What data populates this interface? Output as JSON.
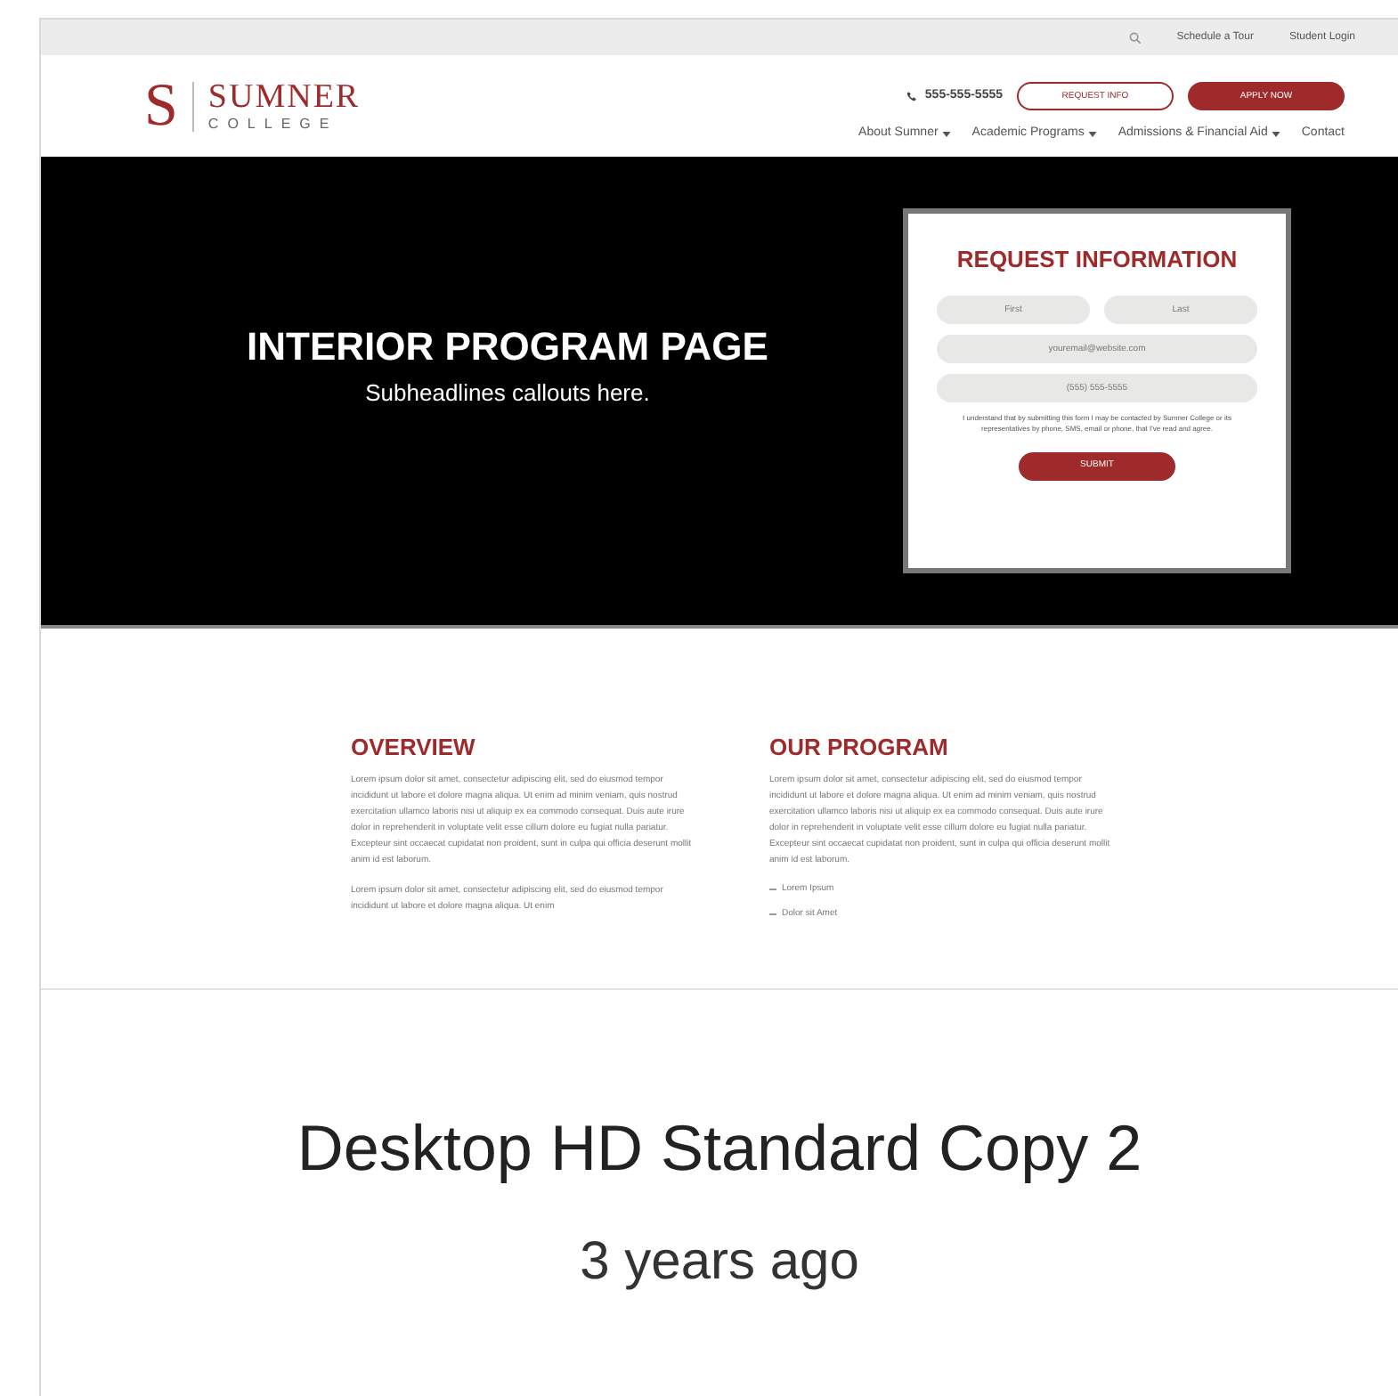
{
  "preview": {
    "utility_bar": {
      "links": [
        "Schedule a Tour",
        "Student Login"
      ]
    },
    "header": {
      "logo_mark": "S",
      "logo_name": "SUMNER",
      "logo_sub": "COLLEGE",
      "phone": "555-555-5555",
      "buttons": [
        {
          "label": "REQUEST INFO",
          "kind": "outline"
        },
        {
          "label": "APPLY NOW",
          "kind": "filled"
        }
      ],
      "nav": [
        {
          "label": "About Sumner",
          "dropdown": true
        },
        {
          "label": "Academic Programs",
          "dropdown": true
        },
        {
          "label": "Admissions & Financial Aid",
          "dropdown": true
        },
        {
          "label": "Contact",
          "dropdown": false
        }
      ]
    },
    "hero": {
      "title": "INTERIOR PROGRAM PAGE",
      "subtitle": "Subheadlines callouts here.",
      "form": {
        "title": "REQUEST INFORMATION",
        "fields": [
          [
            {
              "placeholder": "First"
            },
            {
              "placeholder": "Last"
            }
          ],
          [
            {
              "placeholder": "youremail@website.com"
            }
          ],
          [
            {
              "placeholder": "(555) 555-5555"
            }
          ]
        ],
        "disclaimer": "I understand that by submitting this form I may be contacted by Sumner College or its representatives by phone, SMS, email or phone, that I've read and agree.",
        "submit": "SUBMIT"
      }
    },
    "sections": [
      {
        "title": "OVERVIEW",
        "paragraphs": [
          "Lorem ipsum dolor sit amet, consectetur adipiscing elit, sed do eiusmod tempor incididunt ut labore et dolore magna aliqua. Ut enim ad minim veniam, quis nostrud exercitation ullamco laboris nisi ut aliquip ex ea commodo consequat. Duis aute irure dolor in reprehenderit in voluptate velit esse cillum dolore eu fugiat nulla pariatur. Excepteur sint occaecat cupidatat non proident, sunt in culpa qui officia deserunt mollit anim id est laborum.",
          "Lorem ipsum dolor sit amet, consectetur adipiscing elit, sed do eiusmod tempor incididunt ut labore et dolore magna aliqua. Ut enim"
        ]
      },
      {
        "title": "OUR PROGRAM",
        "paragraphs": [
          "Lorem ipsum dolor sit amet, consectetur adipiscing elit, sed do eiusmod tempor incididunt ut labore et dolore magna aliqua. Ut enim ad minim veniam, quis nostrud exercitation ullamco laboris nisi ut aliquip ex ea commodo consequat. Duis aute irure dolor in reprehenderit in voluptate velit esse cillum dolore eu fugiat nulla pariatur. Excepteur sint occaecat cupidatat non proident, sunt in culpa qui officia deserunt mollit anim id est laborum."
        ],
        "bullets": [
          "Lorem Ipsum",
          "Dolor sit Amet"
        ]
      }
    ]
  },
  "caption": {
    "title": "Desktop HD Standard Copy 2",
    "time": "3 years ago"
  }
}
